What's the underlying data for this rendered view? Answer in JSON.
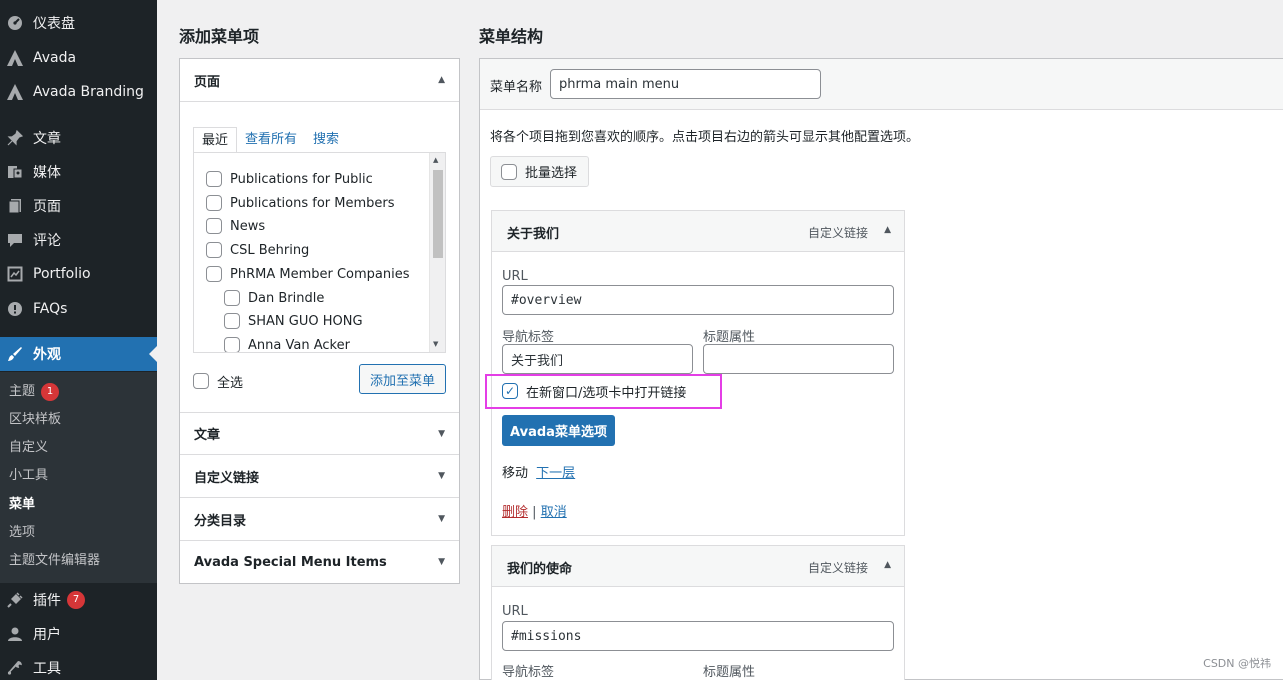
{
  "sidebar": {
    "items": [
      {
        "label": "仪表盘",
        "icon": "dashboard-icon"
      },
      {
        "label": "Avada",
        "icon": "avada-icon"
      },
      {
        "label": "Avada Branding",
        "icon": "avada-icon"
      },
      {
        "label": "文章",
        "icon": "pushpin-icon"
      },
      {
        "label": "媒体",
        "icon": "media-icon"
      },
      {
        "label": "页面",
        "icon": "page-icon"
      },
      {
        "label": "评论",
        "icon": "comment-icon"
      },
      {
        "label": "Portfolio",
        "icon": "portfolio-icon"
      },
      {
        "label": "FAQs",
        "icon": "info-icon"
      },
      {
        "label": "外观",
        "icon": "brush-icon"
      },
      {
        "label": "插件",
        "icon": "plugin-icon",
        "badge": "7"
      },
      {
        "label": "用户",
        "icon": "user-icon"
      },
      {
        "label": "工具",
        "icon": "wrench-icon"
      }
    ],
    "submenu": [
      {
        "label": "主题",
        "badge": "1"
      },
      {
        "label": "区块样板"
      },
      {
        "label": "自定义"
      },
      {
        "label": "小工具"
      },
      {
        "label": "菜单"
      },
      {
        "label": "选项"
      },
      {
        "label": "主题文件编辑器"
      }
    ]
  },
  "left": {
    "heading": "添加菜单项",
    "pages_section": "页面",
    "tabs": [
      "最近",
      "查看所有",
      "搜索"
    ],
    "list": [
      "Publications for Public",
      "Publications for Members",
      "News",
      "CSL Behring",
      "PhRMA Member Companies",
      "Dan Brindle",
      "SHAN GUO HONG",
      "Anna Van Acker"
    ],
    "select_all": "全选",
    "add_button": "添加至菜单",
    "sections": [
      "文章",
      "自定义链接",
      "分类目录",
      "Avada Special Menu Items"
    ]
  },
  "right": {
    "heading": "菜单结构",
    "name_label": "菜单名称",
    "name_value": "phrma main menu",
    "instructions": "将各个项目拖到您喜欢的顺序。点击项目右边的箭头可显示其他配置选项。",
    "bulk_select": "批量选择",
    "item1": {
      "title": "关于我们",
      "type": "自定义链接",
      "url_label": "URL",
      "url": "#overview",
      "nav_label": "导航标签",
      "nav_value": "关于我们",
      "title_attr_label": "标题属性",
      "title_attr_value": "",
      "new_tab_label": "在新窗口/选项卡中打开链接",
      "new_tab_checked": true,
      "avada_button": "Avada菜单选项",
      "move_label": "移动",
      "move_link": "下一层",
      "delete": "删除",
      "separator": "|",
      "cancel": "取消"
    },
    "item2": {
      "title": "我们的使命",
      "type": "自定义链接",
      "url_label": "URL",
      "url": "#missions",
      "nav_label": "导航标签",
      "title_attr_label": "标题属性"
    }
  },
  "watermark": "CSDN @悦祎",
  "colors": {
    "sidebar_bg": "#1d2327",
    "accent": "#2271b1",
    "badge": "#d63638",
    "highlight": "#e43ee6"
  }
}
